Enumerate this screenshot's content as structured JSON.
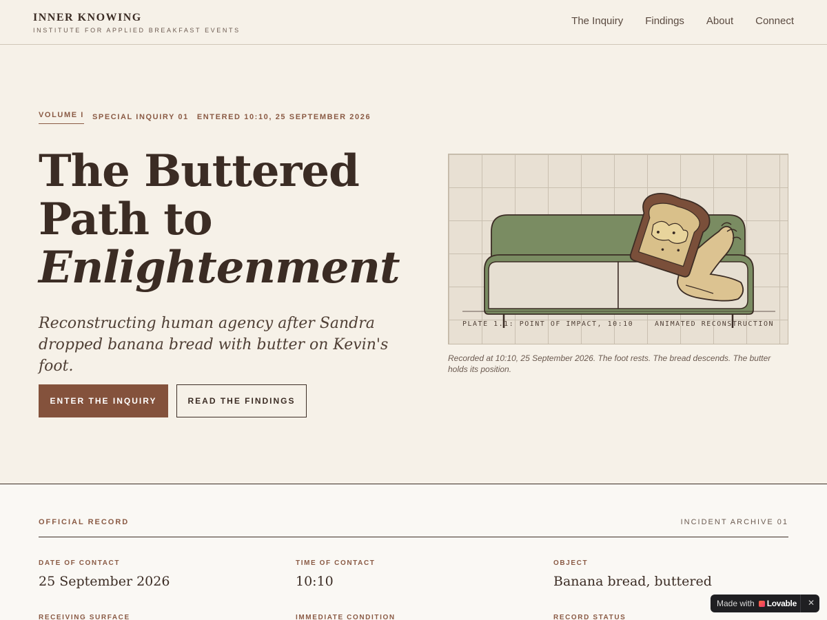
{
  "header": {
    "brand_title": "INNER KNOWING",
    "brand_subtitle": "INSTITUTE FOR APPLIED BREAKFAST EVENTS",
    "nav": [
      {
        "label": "The Inquiry"
      },
      {
        "label": "Findings"
      },
      {
        "label": "About"
      },
      {
        "label": "Connect"
      }
    ]
  },
  "hero": {
    "volume": "VOLUME I",
    "inquiry": "SPECIAL INQUIRY 01",
    "entered": "ENTERED 10:10, 25 SEPTEMBER 2026",
    "title_line1": "The Buttered",
    "title_line2": "Path to",
    "title_line3": "Enlightenment",
    "subtitle": "Reconstructing human agency after Sandra dropped banana bread with butter on Kevin's foot.",
    "primary_button": "ENTER THE INQUIRY",
    "secondary_button": "READ THE FINDINGS"
  },
  "plate": {
    "label_left": "PLATE 1.1: POINT OF IMPACT, 10:10",
    "label_right": "ANIMATED RECONSTRUCTION",
    "caption": "Recorded at 10:10, 25 September 2026. The foot rests. The bread descends. The butter holds its position.",
    "colors": {
      "sofa": "#7a8c62",
      "cushion": "#e6dfd2",
      "bread_crust": "#7a4f3a",
      "bread_crumb": "#d9c08a",
      "foot": "#dcc391"
    }
  },
  "record": {
    "heading": "OFFICIAL RECORD",
    "archive": "INCIDENT ARCHIVE 01",
    "fields": [
      {
        "label": "DATE OF CONTACT",
        "value": "25 September 2026"
      },
      {
        "label": "TIME OF CONTACT",
        "value": "10:10"
      },
      {
        "label": "OBJECT",
        "value": "Banana bread, buttered"
      },
      {
        "label": "RECEIVING SURFACE",
        "value": ""
      },
      {
        "label": "IMMEDIATE CONDITION",
        "value": ""
      },
      {
        "label": "RECORD STATUS",
        "value": ""
      }
    ]
  },
  "badge": {
    "made_with": "Made with",
    "brand": "Lovable",
    "close": "✕"
  }
}
